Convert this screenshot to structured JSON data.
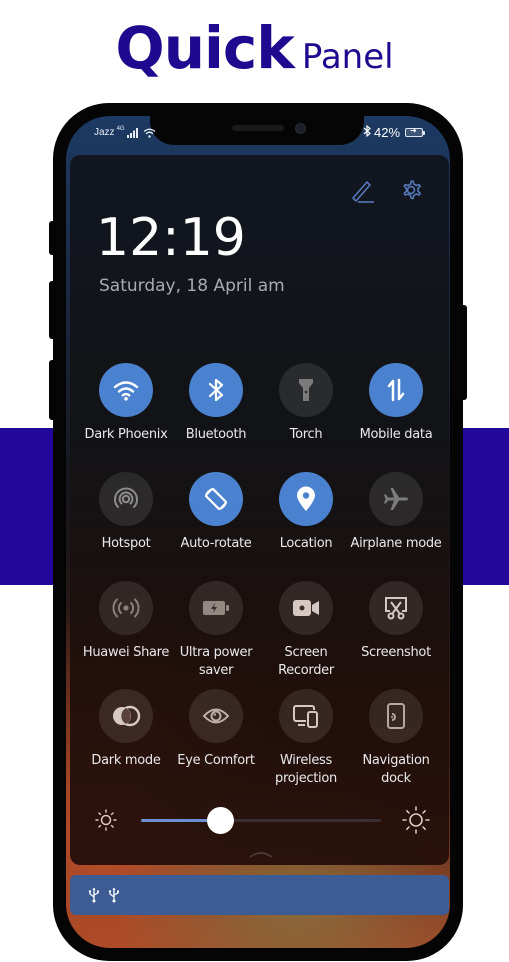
{
  "banner": {
    "title_bold": "Quick",
    "title_regular": "Panel",
    "accent_color": "#1f0a8f",
    "band_color": "#23069a"
  },
  "status_bar": {
    "carrier": "Jazz",
    "network": "4G",
    "battery_percent": "42%",
    "bluetooth_glyph": "✱",
    "charging": true
  },
  "header": {
    "edit_icon": "pencil-icon",
    "settings_icon": "gear-icon",
    "time": "12:19",
    "date": "Saturday, 18 April  am"
  },
  "tiles": [
    {
      "label": "Dark Phoenix",
      "icon": "wifi-icon",
      "active": true
    },
    {
      "label": "Bluetooth",
      "icon": "bluetooth-icon",
      "active": true
    },
    {
      "label": "Torch",
      "icon": "flashlight-icon",
      "active": false
    },
    {
      "label": "Mobile data",
      "icon": "data-arrows-icon",
      "active": true
    },
    {
      "label": "Hotspot",
      "icon": "hotspot-icon",
      "active": false
    },
    {
      "label": "Auto-rotate",
      "icon": "rotate-icon",
      "active": true
    },
    {
      "label": "Location",
      "icon": "location-pin-icon",
      "active": true
    },
    {
      "label": "Airplane mode",
      "icon": "airplane-icon",
      "active": false
    },
    {
      "label": "Huawei Share",
      "icon": "share-broadcast-icon",
      "active": false
    },
    {
      "label": "Ultra power\nsaver",
      "icon": "battery-bolt-icon",
      "active": false
    },
    {
      "label": "Screen\nRecorder",
      "icon": "video-camera-icon",
      "active": false
    },
    {
      "label": "Screenshot",
      "icon": "screenshot-scissors-icon",
      "active": false
    },
    {
      "label": "Dark mode",
      "icon": "dark-mode-icon",
      "active": false
    },
    {
      "label": "Eye Comfort",
      "icon": "eye-icon",
      "active": false
    },
    {
      "label": "Wireless\nprojection",
      "icon": "projection-devices-icon",
      "active": false
    },
    {
      "label": "Navigation\ndock",
      "icon": "navigation-dock-icon",
      "active": false
    }
  ],
  "brightness": {
    "level_percent": 33,
    "accent_color": "#6b8fd0"
  },
  "notification": {
    "icons": [
      "usb-icon",
      "usb-icon"
    ],
    "usb_glyph": "⭍"
  },
  "colors": {
    "tile_active": "#4a82cf",
    "status_bar": "#1d3a63"
  }
}
